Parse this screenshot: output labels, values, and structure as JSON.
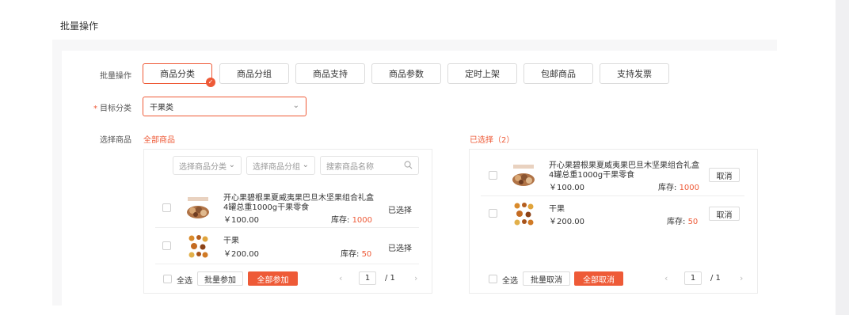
{
  "page": {
    "title": "批量操作"
  },
  "form": {
    "batch_label": "批量操作",
    "target_label": "目标分类",
    "target_required": "*",
    "select_label": "选择商品"
  },
  "operations": [
    {
      "label": "商品分类",
      "active": true
    },
    {
      "label": "商品分组",
      "active": false
    },
    {
      "label": "商品支持",
      "active": false
    },
    {
      "label": "商品参数",
      "active": false
    },
    {
      "label": "定时上架",
      "active": false
    },
    {
      "label": "包邮商品",
      "active": false
    },
    {
      "label": "支持发票",
      "active": false
    }
  ],
  "target_select": {
    "value": "干果类"
  },
  "left_panel": {
    "title": "全部商品",
    "filter_category": "选择商品分类",
    "filter_group": "选择商品分组",
    "search_placeholder": "搜索商品名称",
    "items": [
      {
        "name": "开心果碧根果夏威夷果巴旦木坚果组合礼盒4罐总重1000g干果零食",
        "price": "￥100.00",
        "stock_label": "库存:",
        "stock": "1000",
        "status": "已选择"
      },
      {
        "name": "干果",
        "price": "￥200.00",
        "stock_label": "库存:",
        "stock": "50",
        "status": "已选择"
      }
    ],
    "select_all": "全选",
    "batch_add": "批量参加",
    "add_all": "全部参加",
    "page": "1",
    "total": "/ 1"
  },
  "right_panel": {
    "title": "已选择（2）",
    "items": [
      {
        "name": "开心果碧根果夏威夷果巴旦木坚果组合礼盒4罐总重1000g干果零食",
        "price": "￥100.00",
        "stock_label": "库存:",
        "stock": "1000",
        "action": "取消"
      },
      {
        "name": "干果",
        "price": "￥200.00",
        "stock_label": "库存:",
        "stock": "50",
        "action": "取消"
      }
    ],
    "select_all": "全选",
    "batch_cancel": "批量取消",
    "cancel_all": "全部取消",
    "page": "1",
    "total": "/ 1"
  },
  "colors": {
    "accent": "#ee5a37"
  }
}
